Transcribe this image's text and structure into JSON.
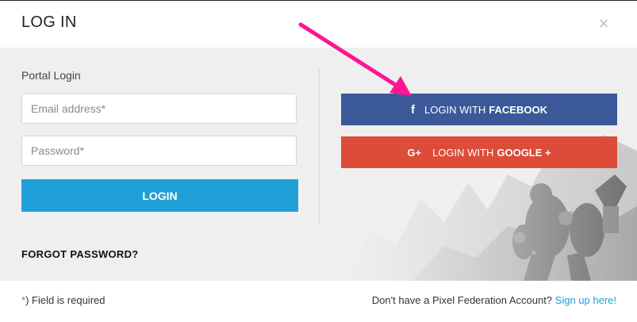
{
  "header": {
    "title": "LOG IN",
    "close_glyph": "×"
  },
  "login_form": {
    "section_label": "Portal Login",
    "email_placeholder": "Email address*",
    "password_placeholder": "Password*",
    "login_label": "LOGIN",
    "forgot_label": "FORGOT PASSWORD?"
  },
  "social": {
    "facebook": {
      "icon": "facebook-icon",
      "glyph": "f",
      "prefix": "LOGIN WITH",
      "brand": "FACEBOOK",
      "color": "#3b5998"
    },
    "google": {
      "icon": "google-plus-icon",
      "glyph": "G+",
      "prefix": "LOGIN WITH",
      "brand": "GOOGLE +",
      "color": "#dd4b39"
    }
  },
  "footer": {
    "required_star": "*",
    "required_text": ") Field is required",
    "account_question": "Don't have a Pixel Federation Account?",
    "signup_label": "Sign up here!"
  },
  "colors": {
    "accent": "#1fa0d6",
    "annotation_arrow": "#ff1493"
  }
}
